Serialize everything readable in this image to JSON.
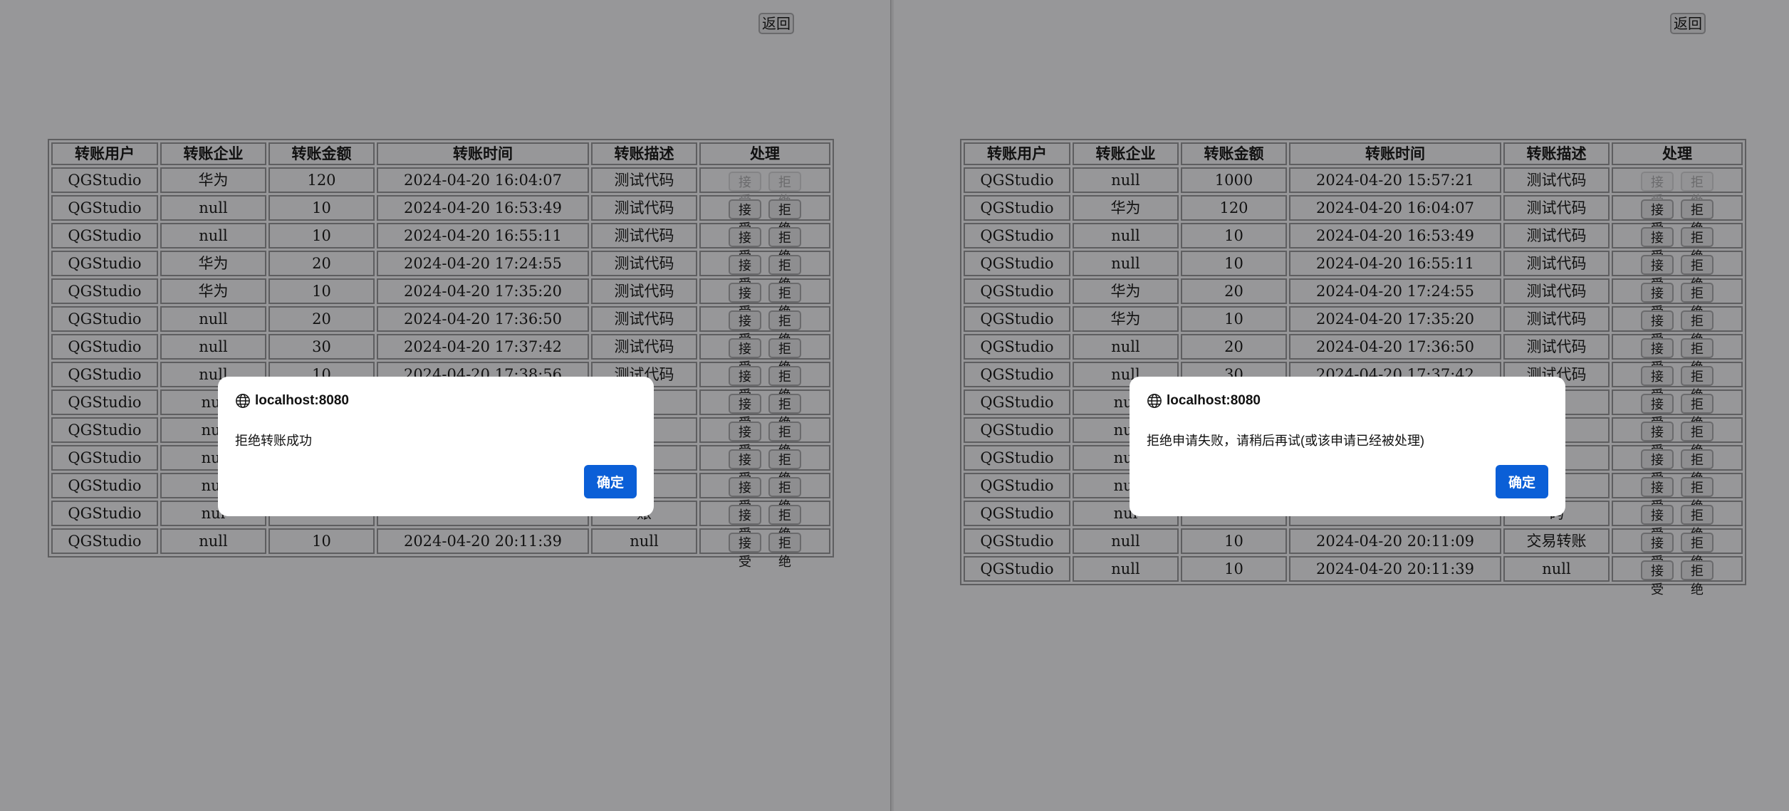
{
  "back_label": "返回",
  "headers": [
    "转账用户",
    "转账企业",
    "转账金额",
    "转账时间",
    "转账描述",
    "处理"
  ],
  "accept_label": "接受",
  "reject_label": "拒绝",
  "left": {
    "rows": [
      [
        "QGStudio",
        "华为",
        "120",
        "2024-04-20 16:04:07",
        "测试代码"
      ],
      [
        "QGStudio",
        "null",
        "10",
        "2024-04-20 16:53:49",
        "测试代码"
      ],
      [
        "QGStudio",
        "null",
        "10",
        "2024-04-20 16:55:11",
        "测试代码"
      ],
      [
        "QGStudio",
        "华为",
        "20",
        "2024-04-20 17:24:55",
        "测试代码"
      ],
      [
        "QGStudio",
        "华为",
        "10",
        "2024-04-20 17:35:20",
        "测试代码"
      ],
      [
        "QGStudio",
        "null",
        "20",
        "2024-04-20 17:36:50",
        "测试代码"
      ],
      [
        "QGStudio",
        "null",
        "30",
        "2024-04-20 17:37:42",
        "测试代码"
      ],
      [
        "QGStudio",
        "null",
        "10",
        "2024-04-20 17:38:56",
        "测试代码"
      ],
      [
        "QGStudio",
        "nul",
        "",
        "",
        "码"
      ],
      [
        "QGStudio",
        "nul",
        "",
        "",
        "码"
      ],
      [
        "QGStudio",
        "nul",
        "",
        "",
        "码"
      ],
      [
        "QGStudio",
        "nul",
        "",
        "",
        "码"
      ],
      [
        "QGStudio",
        "nul",
        "",
        "",
        "账"
      ],
      [
        "QGStudio",
        "null",
        "10",
        "2024-04-20 20:11:39",
        "null"
      ]
    ],
    "disabled_rows": [
      0
    ],
    "dialog": {
      "host": "localhost:8080",
      "message": "拒绝转账成功",
      "ok": "确定"
    }
  },
  "right": {
    "rows": [
      [
        "QGStudio",
        "null",
        "1000",
        "2024-04-20 15:57:21",
        "测试代码"
      ],
      [
        "QGStudio",
        "华为",
        "120",
        "2024-04-20 16:04:07",
        "测试代码"
      ],
      [
        "QGStudio",
        "null",
        "10",
        "2024-04-20 16:53:49",
        "测试代码"
      ],
      [
        "QGStudio",
        "null",
        "10",
        "2024-04-20 16:55:11",
        "测试代码"
      ],
      [
        "QGStudio",
        "华为",
        "20",
        "2024-04-20 17:24:55",
        "测试代码"
      ],
      [
        "QGStudio",
        "华为",
        "10",
        "2024-04-20 17:35:20",
        "测试代码"
      ],
      [
        "QGStudio",
        "null",
        "20",
        "2024-04-20 17:36:50",
        "测试代码"
      ],
      [
        "QGStudio",
        "null",
        "30",
        "2024-04-20 17:37:42",
        "测试代码"
      ],
      [
        "QGStudio",
        "nul",
        "",
        "",
        "码"
      ],
      [
        "QGStudio",
        "nul",
        "",
        "",
        "码"
      ],
      [
        "QGStudio",
        "nul",
        "",
        "",
        "码"
      ],
      [
        "QGStudio",
        "nul",
        "",
        "",
        "码"
      ],
      [
        "QGStudio",
        "nul",
        "",
        "",
        "码"
      ],
      [
        "QGStudio",
        "null",
        "10",
        "2024-04-20 20:11:09",
        "交易转账"
      ],
      [
        "QGStudio",
        "null",
        "10",
        "2024-04-20 20:11:39",
        "null"
      ]
    ],
    "disabled_rows": [
      0
    ],
    "dialog": {
      "host": "localhost:8080",
      "message": "拒绝申请失败，请稍后再试(或该申请已经被处理)",
      "ok": "确定"
    }
  }
}
